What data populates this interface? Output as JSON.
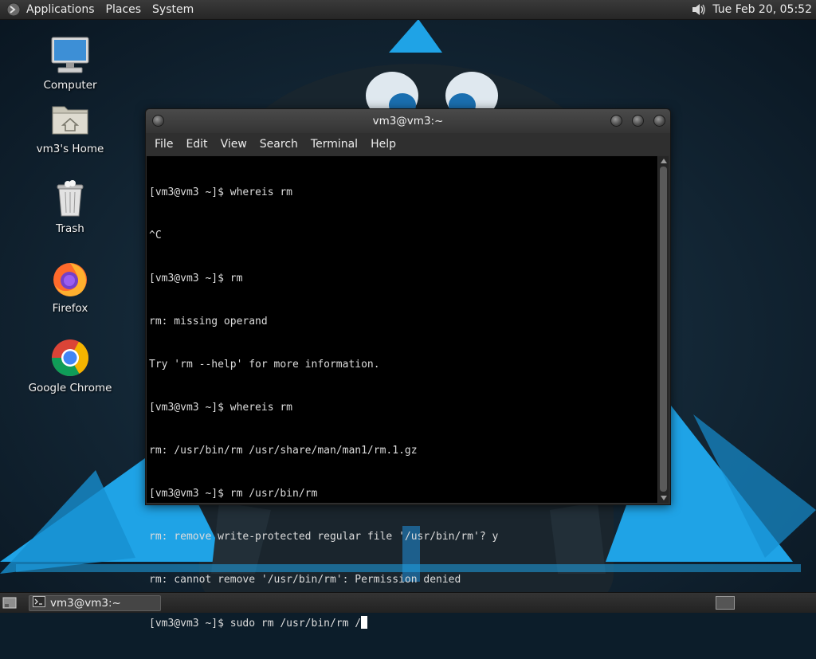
{
  "top_panel": {
    "menus": [
      "Applications",
      "Places",
      "System"
    ],
    "clock": "Tue Feb 20, 05:52",
    "volume_icon": "speaker-icon"
  },
  "desktop_icons": [
    {
      "label": "Computer",
      "icon": "computer-icon"
    },
    {
      "label": "vm3's Home",
      "icon": "home-folder-icon"
    },
    {
      "label": "Trash",
      "icon": "trash-icon"
    },
    {
      "label": "Firefox",
      "icon": "firefox-icon"
    },
    {
      "label": "Google Chrome",
      "icon": "chrome-icon"
    }
  ],
  "terminal": {
    "title": "vm3@vm3:~",
    "menu": [
      "File",
      "Edit",
      "View",
      "Search",
      "Terminal",
      "Help"
    ],
    "lines": [
      "[vm3@vm3 ~]$ whereis rm",
      "^C",
      "[vm3@vm3 ~]$ rm",
      "rm: missing operand",
      "Try 'rm --help' for more information.",
      "[vm3@vm3 ~]$ whereis rm",
      "rm: /usr/bin/rm /usr/share/man/man1/rm.1.gz",
      "[vm3@vm3 ~]$ rm /usr/bin/rm",
      "rm: remove write-protected regular file '/usr/bin/rm'? y",
      "rm: cannot remove '/usr/bin/rm': Permission denied"
    ],
    "current_input": "[vm3@vm3 ~]$ sudo rm /usr/bin/rm /"
  },
  "bottom_panel": {
    "task_label": "vm3@vm3:~"
  },
  "colors": {
    "accent_blue": "#1fa3e6",
    "terminal_bg": "#000000",
    "panel_bg": "#2b2b2b"
  }
}
